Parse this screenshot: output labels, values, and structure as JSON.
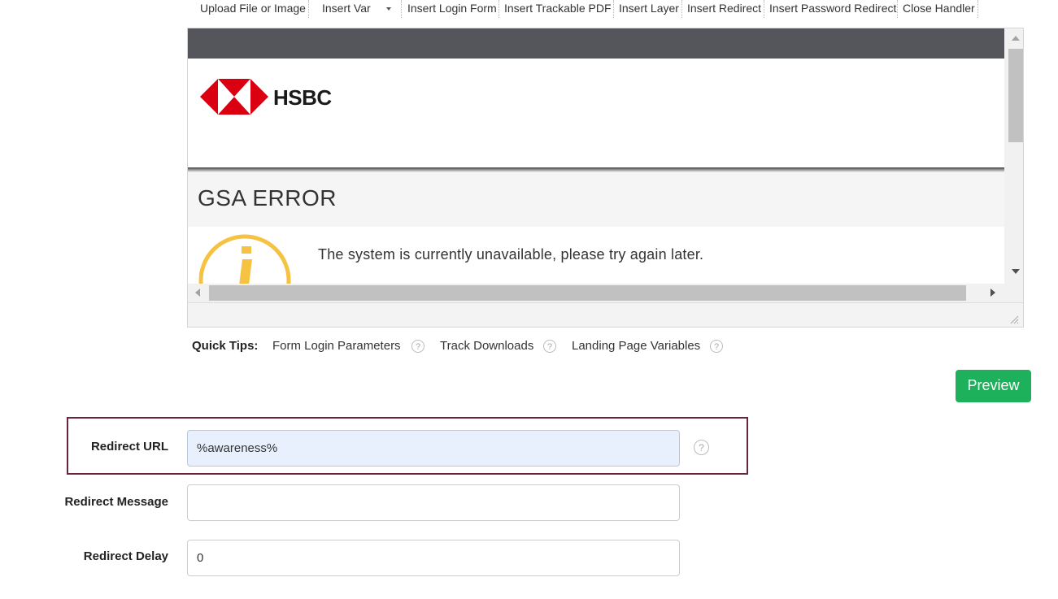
{
  "toolbar": {
    "buttons": [
      "Upload File or Image",
      "Insert Var",
      "Insert Login Form",
      "Insert Trackable PDF",
      "Insert Layer",
      "Insert Redirect",
      "Insert Password Redirect",
      "Close Handler"
    ]
  },
  "editor": {
    "logo_text": "HSBC",
    "error_title": "GSA ERROR",
    "error_message": "The system is currently unavailable, please try again later.",
    "colors": {
      "banner": "#54565b",
      "logo_red": "#db0011",
      "info_yellow": "#f5c242"
    }
  },
  "quick_tips": {
    "label": "Quick Tips:",
    "links": [
      "Form Login Parameters",
      "Track Downloads",
      "Landing Page Variables"
    ]
  },
  "preview_button": "Preview",
  "form": {
    "redirect_url_label": "Redirect URL",
    "redirect_url_value": "%awareness%",
    "redirect_message_label": "Redirect Message",
    "redirect_message_value": "",
    "redirect_delay_label": "Redirect Delay",
    "redirect_delay_value": "0"
  },
  "colors": {
    "accent_green": "#1eb15c",
    "highlight_border": "#6b2440"
  }
}
